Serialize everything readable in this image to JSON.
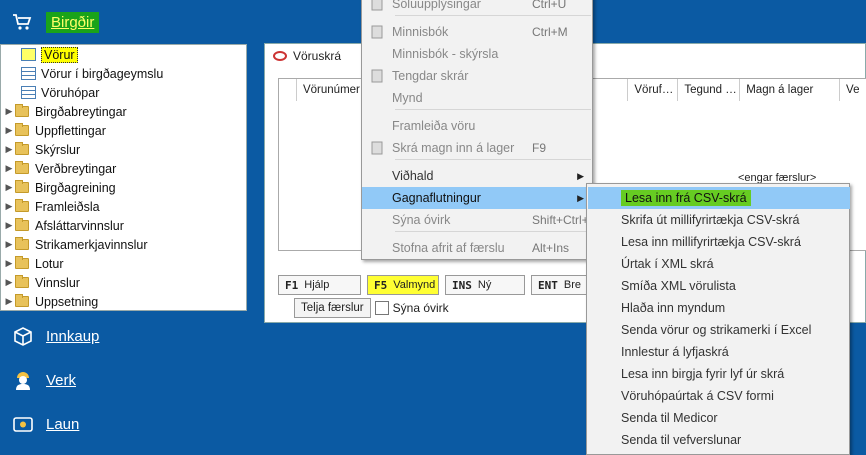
{
  "nav": {
    "birgdir": "Birgðir",
    "tree": [
      {
        "label": "Vörur",
        "type": "grid",
        "selected": true
      },
      {
        "label": "Vörur í birgðageymslu",
        "type": "grid"
      },
      {
        "label": "Vöruhópar",
        "type": "grid"
      },
      {
        "label": "Birgðabreytingar",
        "type": "folder"
      },
      {
        "label": "Uppflettingar",
        "type": "folder"
      },
      {
        "label": "Skýrslur",
        "type": "folder"
      },
      {
        "label": "Verðbreytingar",
        "type": "folder"
      },
      {
        "label": "Birgðagreining",
        "type": "folder"
      },
      {
        "label": "Framleiðsla",
        "type": "folder"
      },
      {
        "label": "Afsláttarvinnslur",
        "type": "folder"
      },
      {
        "label": "Strikamerkjavinnslur",
        "type": "folder"
      },
      {
        "label": "Lotur",
        "type": "folder"
      },
      {
        "label": "Vinnslur",
        "type": "folder"
      },
      {
        "label": "Uppsetning",
        "type": "folder"
      }
    ],
    "innkaup": "Innkaup",
    "verk": "Verk",
    "laun": "Laun"
  },
  "window": {
    "title": "Vöruskrá",
    "columns": [
      "Vörunúmer",
      "Vöruf…",
      "Tegund …",
      "Magn á lager",
      "Ve"
    ],
    "empty": "<engar færslur>",
    "fkeys": [
      {
        "key": "F1",
        "label": "Hjálp"
      },
      {
        "key": "F5",
        "label": "Valmynd"
      },
      {
        "key": "INS",
        "label": "Ný"
      },
      {
        "key": "ENT",
        "label": "Bre"
      }
    ],
    "count_button": "Telja færslur",
    "show_invalid": "Sýna óvirk"
  },
  "menu1": [
    {
      "label": "Söluupplýsingar",
      "shortcut": "Ctrl+U",
      "icon": "document-icon",
      "disabled": true
    },
    {
      "label": "Minnisbók",
      "shortcut": "Ctrl+M",
      "icon": "notebook-icon",
      "disabled": true
    },
    {
      "label": "Minnisbók - skýrsla",
      "shortcut": "",
      "icon": "",
      "disabled": true
    },
    {
      "label": "Tengdar skrár",
      "shortcut": "",
      "icon": "attachment-icon",
      "disabled": true
    },
    {
      "label": "Mynd",
      "shortcut": "",
      "icon": "",
      "disabled": true
    },
    {
      "label": "Framleiða vöru",
      "shortcut": "",
      "icon": "",
      "disabled": true
    },
    {
      "label": "Skrá magn inn á lager",
      "shortcut": "F9",
      "icon": "cart-icon",
      "disabled": true
    },
    {
      "label": "Viðhald",
      "shortcut": "",
      "icon": "",
      "disabled": false,
      "submenu": true
    },
    {
      "label": "Gagnaflutningur",
      "shortcut": "",
      "icon": "",
      "disabled": false,
      "submenu": true,
      "highlight": true
    },
    {
      "label": "Sýna óvirk",
      "shortcut": "Shift+Ctrl+S",
      "icon": "",
      "disabled": true
    },
    {
      "label": "Stofna afrit af færslu",
      "shortcut": "Alt+Ins",
      "icon": "",
      "disabled": true
    }
  ],
  "menu2": [
    {
      "label": "Lesa inn frá CSV-skrá",
      "highlight": true
    },
    {
      "label": "Skrifa út millifyrirtækja CSV-skrá"
    },
    {
      "label": "Lesa inn millifyrirtækja CSV-skrá"
    },
    {
      "label": "Úrtak í XML skrá"
    },
    {
      "label": "Smíða XML vörulista"
    },
    {
      "label": "Hlaða inn myndum"
    },
    {
      "label": "Senda vörur og strikamerki í Excel"
    },
    {
      "label": "Innlestur á lyfjaskrá"
    },
    {
      "label": "Lesa inn birgja fyrir lyf úr skrá"
    },
    {
      "label": "Vöruhópaúrtak á CSV formi"
    },
    {
      "label": "Senda til Medicor"
    },
    {
      "label": "Senda til vefverslunar"
    }
  ],
  "colors": {
    "nav_bg": "#0b5aa3",
    "highlight": "#91c9f7",
    "yellow": "#ffff00",
    "green": "#66cc22"
  }
}
